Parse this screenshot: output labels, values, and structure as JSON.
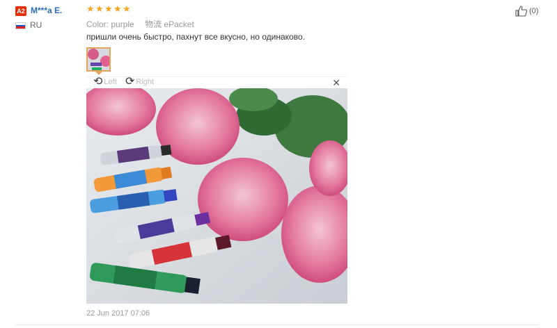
{
  "reviewer": {
    "badge": "A2",
    "name": "M***a E.",
    "country": "RU",
    "flag_colors": [
      "#ffffff",
      "#2255bb",
      "#dd2222"
    ]
  },
  "review": {
    "rating": 5,
    "color_label": "Color:",
    "color_value": "purple",
    "shipping_label": "物流",
    "shipping_value": "ePacket",
    "text": "пришли очень быстро, пахнут все вкусно, но одинаково.",
    "date": "22 Jun 2017 07:06"
  },
  "viewer": {
    "rotate_left": "Left",
    "rotate_right": "Right",
    "close_icon": "close-icon"
  },
  "like": {
    "count": "(0)",
    "icon": "thumbs-up-icon"
  },
  "colors": {
    "star": "#f5a623",
    "badge": "#e62e04",
    "name": "#2b6cb0",
    "thumb_border": "#e8a35b"
  }
}
